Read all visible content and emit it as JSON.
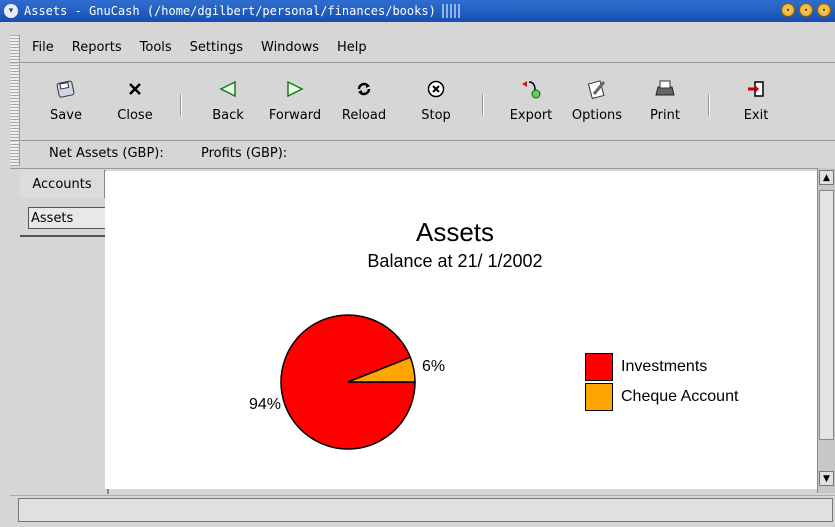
{
  "window": {
    "title": "Assets - GnuCash (/home/dgilbert/personal/finances/books)"
  },
  "menubar": {
    "items": [
      "File",
      "Reports",
      "Tools",
      "Settings",
      "Windows",
      "Help"
    ]
  },
  "toolbar": {
    "save": "Save",
    "close": "Close",
    "back": "Back",
    "forward": "Forward",
    "reload": "Reload",
    "stop": "Stop",
    "export": "Export",
    "options": "Options",
    "print": "Print",
    "exit": "Exit"
  },
  "summary": {
    "net_assets": "Net Assets (GBP):",
    "profits": "Profits (GBP):"
  },
  "tabs": {
    "accounts": "Accounts",
    "assets": "Assets"
  },
  "report": {
    "title": "Assets",
    "subtitle": "Balance at 21/ 1/2002"
  },
  "chart_data": {
    "type": "pie",
    "title": "Assets",
    "subtitle": "Balance at 21/ 1/2002",
    "slices": [
      {
        "name": "Investments",
        "percent": 94,
        "label": "94%",
        "color": "#ff0000"
      },
      {
        "name": "Cheque Account",
        "percent": 6,
        "label": "6%",
        "color": "#ffa500"
      }
    ],
    "legend": {
      "placement": "right",
      "items": [
        "Investments",
        "Cheque Account"
      ]
    }
  },
  "icons": {
    "save": "floppy-icon",
    "close": "close-x-icon",
    "back": "triangle-left-icon",
    "forward": "triangle-right-icon",
    "reload": "reload-icon",
    "stop": "stop-icon",
    "export": "export-icon",
    "options": "options-icon",
    "print": "printer-icon",
    "exit": "exit-icon"
  }
}
